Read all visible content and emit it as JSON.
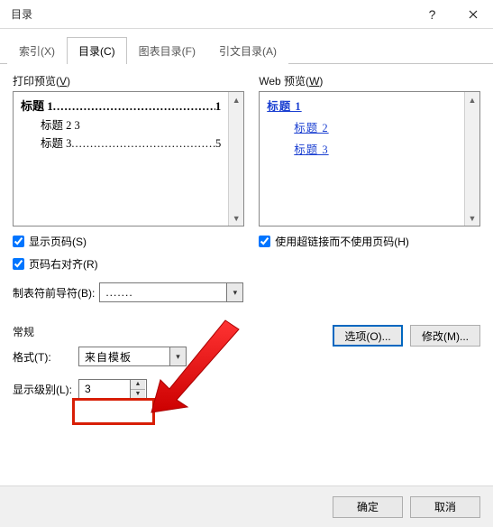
{
  "title": "目录",
  "tabs": {
    "index": "索引(X)",
    "toc": "目录(C)",
    "figures": "图表目录(F)",
    "citations": "引文目录(A)"
  },
  "print_preview": {
    "label_pre": "打印预览(",
    "label_u": "V",
    "label_post": ")",
    "h1_text": "标题 1",
    "h1_page": "1",
    "h2_text": "标题 2",
    "h2_page": "3",
    "h3_text": "标题 3",
    "h3_page": "5"
  },
  "web_preview": {
    "label_pre": "Web 预览(",
    "label_u": "W",
    "label_post": ")",
    "l1": "标题 1",
    "l2": "标题 2",
    "l3": "标题 3"
  },
  "checks": {
    "show_page": "显示页码(S)",
    "right_align": "页码右对齐(R)",
    "use_links": "使用超链接而不使用页码(H)"
  },
  "leader": {
    "label": "制表符前导符(B):",
    "value": "......."
  },
  "general": {
    "title": "常规",
    "format_label": "格式(T):",
    "format_value": "来自模板",
    "levels_label": "显示级别(L):",
    "levels_value": "3"
  },
  "buttons": {
    "options": "选项(O)...",
    "modify": "修改(M)...",
    "ok": "确定",
    "cancel": "取消"
  },
  "dots": "............................................"
}
